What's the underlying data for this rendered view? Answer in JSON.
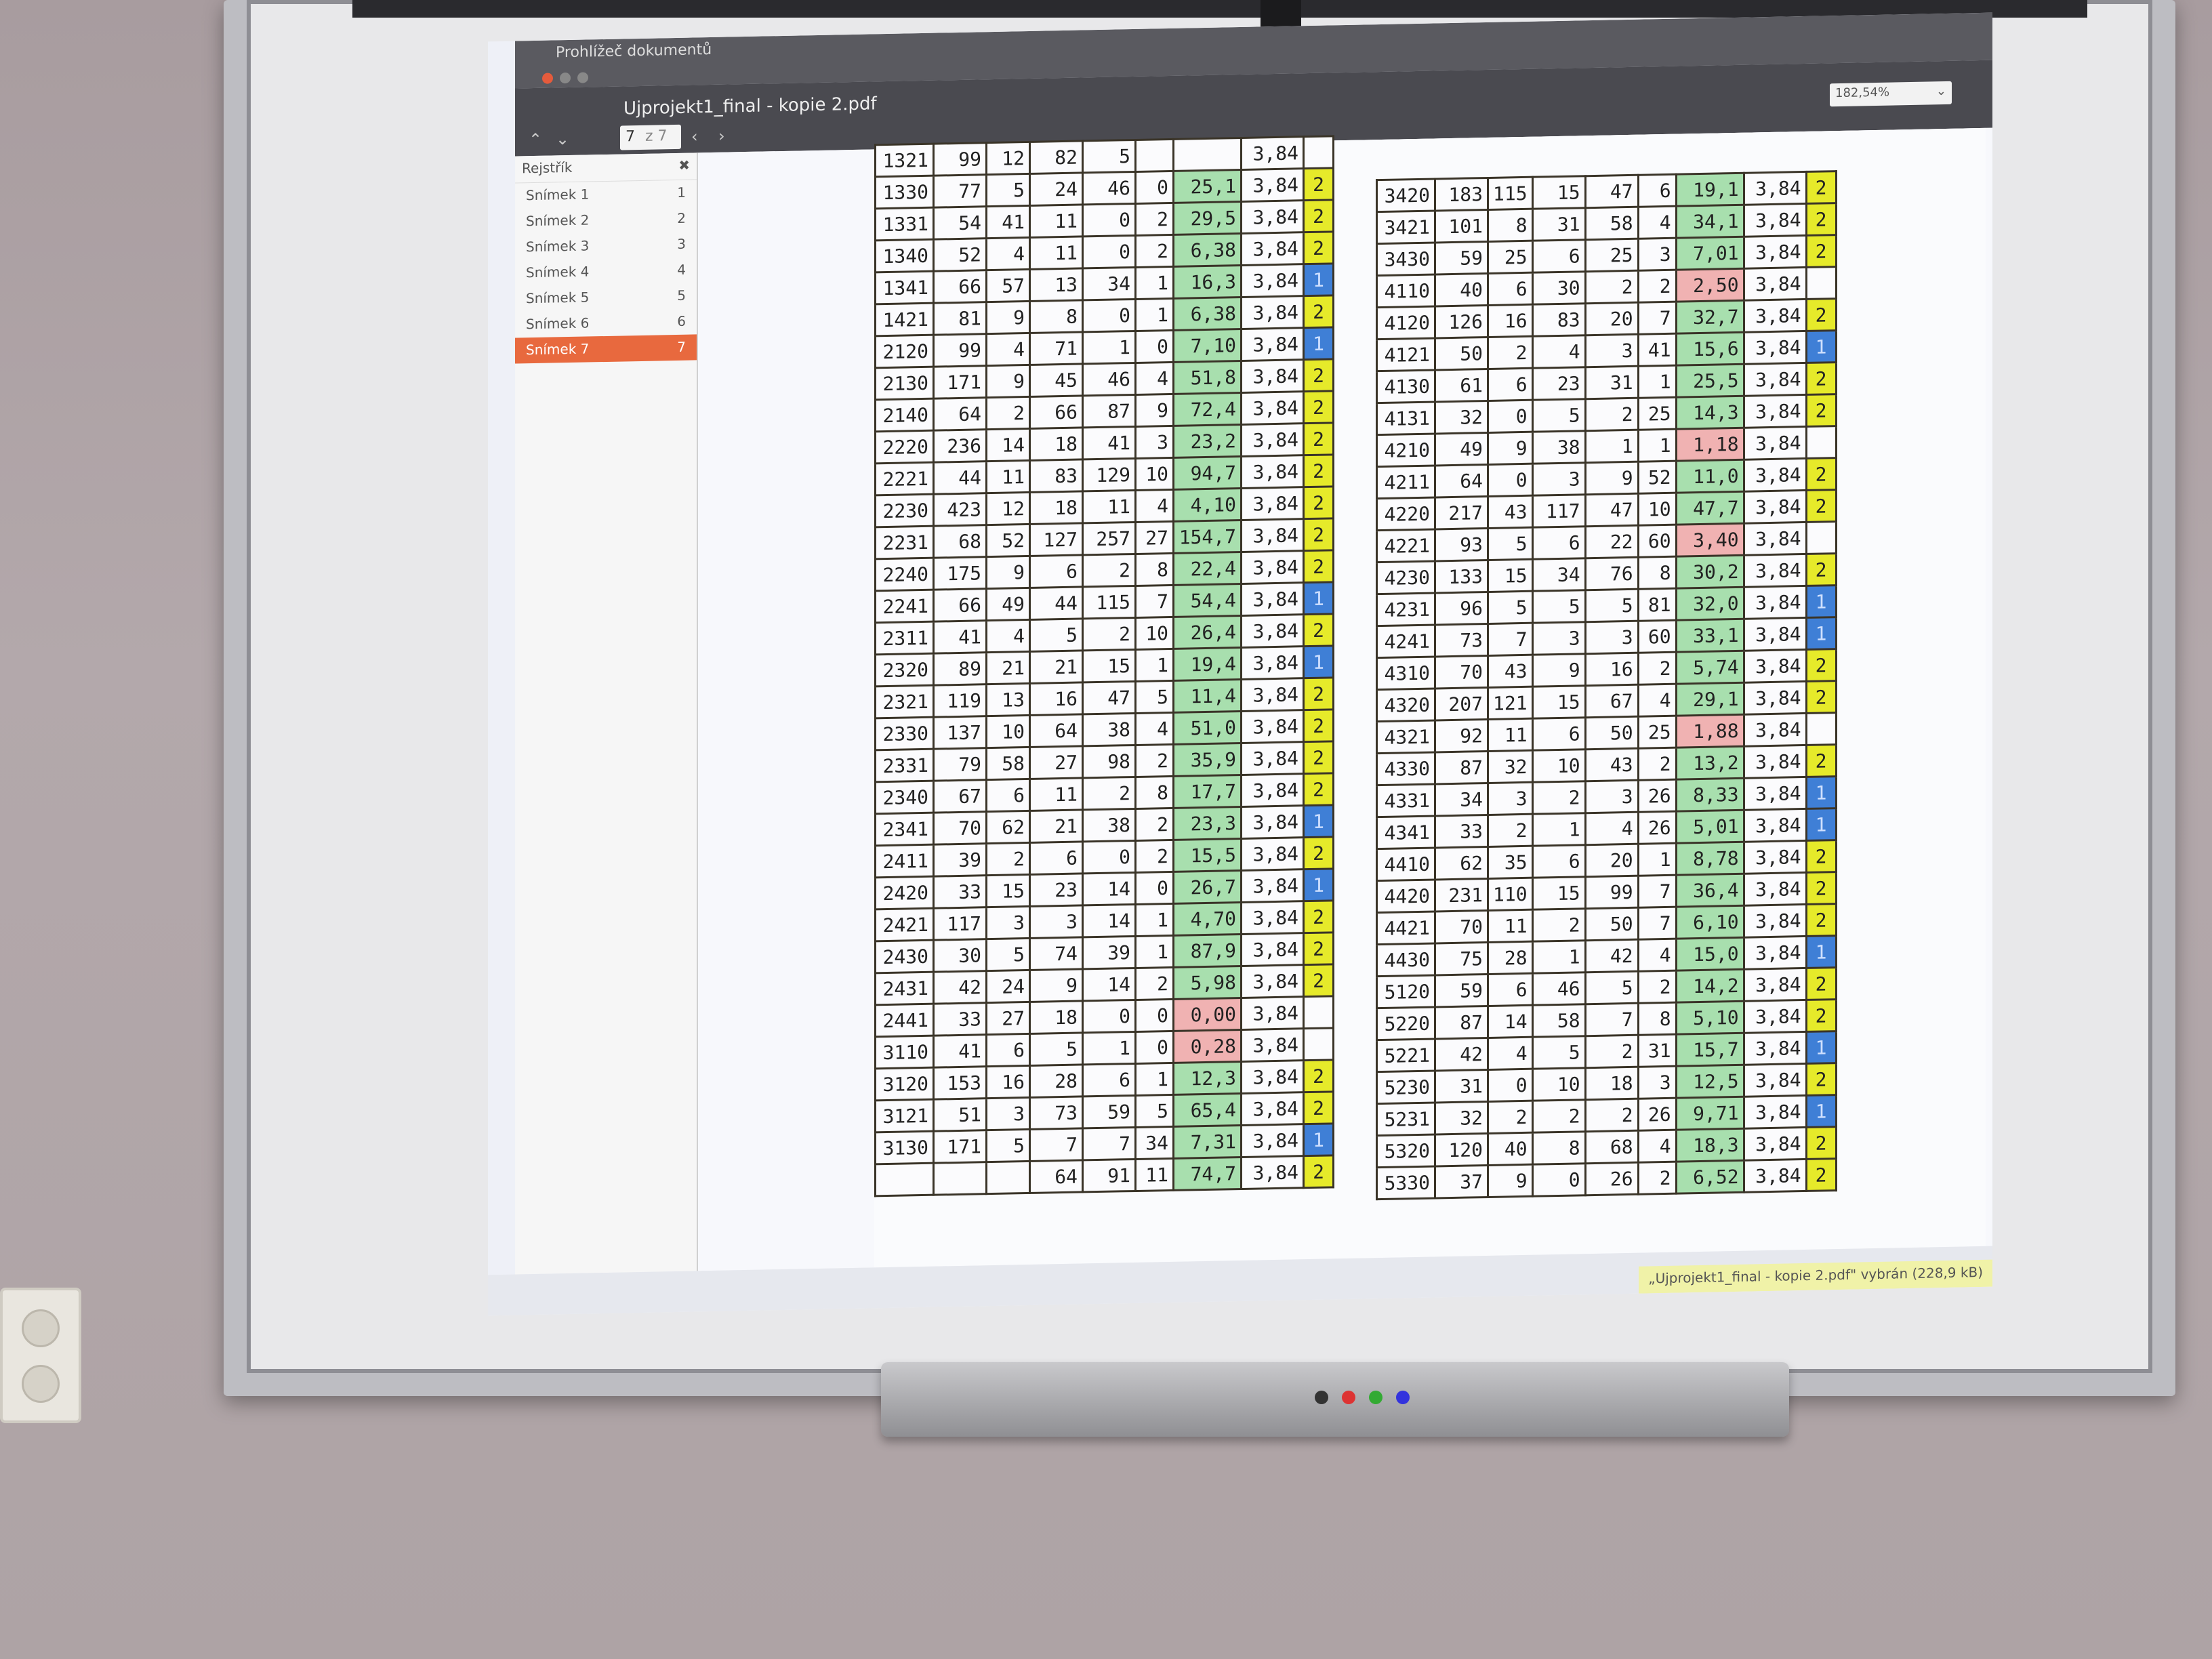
{
  "window": {
    "app_name": "Prohlížeč dokumentů",
    "document_title": "Ujprojekt1_final - kopie 2.pdf",
    "page_field": "7",
    "page_total": "z 7",
    "zoom": "182,54%"
  },
  "sidebar": {
    "header": "Rejstřík",
    "items": [
      {
        "label": "Snímek 1",
        "page": "1"
      },
      {
        "label": "Snímek 2",
        "page": "2"
      },
      {
        "label": "Snímek 3",
        "page": "3"
      },
      {
        "label": "Snímek 4",
        "page": "4"
      },
      {
        "label": "Snímek 5",
        "page": "5"
      },
      {
        "label": "Snímek 6",
        "page": "6"
      },
      {
        "label": "Snímek 7",
        "page": "7"
      }
    ]
  },
  "table_left": [
    [
      "1321",
      "99",
      "12",
      "82",
      "5",
      "",
      "",
      "3,84",
      ""
    ],
    [
      "1330",
      "77",
      "5",
      "24",
      "46",
      "0",
      "25,1",
      "3,84",
      "2"
    ],
    [
      "1331",
      "54",
      "41",
      "11",
      "0",
      "2",
      "29,5",
      "3,84",
      "2"
    ],
    [
      "1340",
      "52",
      "4",
      "11",
      "0",
      "2",
      "6,38",
      "3,84",
      "2"
    ],
    [
      "1341",
      "66",
      "57",
      "13",
      "34",
      "1",
      "16,3",
      "3,84",
      "1"
    ],
    [
      "1421",
      "81",
      "9",
      "8",
      "0",
      "1",
      "6,38",
      "3,84",
      "2"
    ],
    [
      "2120",
      "99",
      "4",
      "71",
      "1",
      "0",
      "7,10",
      "3,84",
      "1"
    ],
    [
      "2130",
      "171",
      "9",
      "45",
      "46",
      "4",
      "51,8",
      "3,84",
      "2"
    ],
    [
      "2140",
      "64",
      "2",
      "66",
      "87",
      "9",
      "72,4",
      "3,84",
      "2"
    ],
    [
      "2220",
      "236",
      "14",
      "18",
      "41",
      "3",
      "23,2",
      "3,84",
      "2"
    ],
    [
      "2221",
      "44",
      "11",
      "83",
      "129",
      "10",
      "94,7",
      "3,84",
      "2"
    ],
    [
      "2230",
      "423",
      "12",
      "18",
      "11",
      "4",
      "4,10",
      "3,84",
      "2"
    ],
    [
      "2231",
      "68",
      "52",
      "127",
      "257",
      "27",
      "154,7",
      "3,84",
      "2"
    ],
    [
      "2240",
      "175",
      "9",
      "6",
      "2",
      "8",
      "22,4",
      "3,84",
      "2"
    ],
    [
      "2241",
      "66",
      "49",
      "44",
      "115",
      "7",
      "54,4",
      "3,84",
      "1"
    ],
    [
      "2311",
      "41",
      "4",
      "5",
      "2",
      "10",
      "26,4",
      "3,84",
      "2"
    ],
    [
      "2320",
      "89",
      "21",
      "21",
      "15",
      "1",
      "19,4",
      "3,84",
      "1"
    ],
    [
      "2321",
      "119",
      "13",
      "16",
      "47",
      "5",
      "11,4",
      "3,84",
      "2"
    ],
    [
      "2330",
      "137",
      "10",
      "64",
      "38",
      "4",
      "51,0",
      "3,84",
      "2"
    ],
    [
      "2331",
      "79",
      "58",
      "27",
      "98",
      "2",
      "35,9",
      "3,84",
      "2"
    ],
    [
      "2340",
      "67",
      "6",
      "11",
      "2",
      "8",
      "17,7",
      "3,84",
      "2"
    ],
    [
      "2341",
      "70",
      "62",
      "21",
      "38",
      "2",
      "23,3",
      "3,84",
      "1"
    ],
    [
      "2411",
      "39",
      "2",
      "6",
      "0",
      "2",
      "15,5",
      "3,84",
      "2"
    ],
    [
      "2420",
      "33",
      "15",
      "23",
      "14",
      "0",
      "26,7",
      "3,84",
      "1"
    ],
    [
      "2421",
      "117",
      "3",
      "3",
      "14",
      "1",
      "4,70",
      "3,84",
      "2"
    ],
    [
      "2430",
      "30",
      "5",
      "74",
      "39",
      "1",
      "87,9",
      "3,84",
      "2"
    ],
    [
      "2431",
      "42",
      "24",
      "9",
      "14",
      "2",
      "5,98",
      "3,84",
      "2"
    ],
    [
      "2441",
      "33",
      "27",
      "18",
      "0",
      "0",
      "0,00",
      "3,84",
      ""
    ],
    [
      "3110",
      "41",
      "6",
      "5",
      "1",
      "0",
      "0,28",
      "3,84",
      ""
    ],
    [
      "3120",
      "153",
      "16",
      "28",
      "6",
      "1",
      "12,3",
      "3,84",
      "2"
    ],
    [
      "3121",
      "51",
      "3",
      "73",
      "59",
      "5",
      "65,4",
      "3,84",
      "2"
    ],
    [
      "3130",
      "171",
      "5",
      "7",
      "7",
      "34",
      "7,31",
      "3,84",
      "1"
    ],
    [
      "",
      "",
      "",
      "64",
      "91",
      "11",
      "74,7",
      "3,84",
      "2"
    ]
  ],
  "table_right": [
    [
      "3420",
      "183",
      "115",
      "15",
      "47",
      "6",
      "19,1",
      "3,84",
      "2"
    ],
    [
      "3421",
      "101",
      "8",
      "31",
      "58",
      "4",
      "34,1",
      "3,84",
      "2"
    ],
    [
      "3430",
      "59",
      "25",
      "6",
      "25",
      "3",
      "7,01",
      "3,84",
      "2"
    ],
    [
      "4110",
      "40",
      "6",
      "30",
      "2",
      "2",
      "2,50",
      "3,84",
      ""
    ],
    [
      "4120",
      "126",
      "16",
      "83",
      "20",
      "7",
      "32,7",
      "3,84",
      "2"
    ],
    [
      "4121",
      "50",
      "2",
      "4",
      "3",
      "41",
      "15,6",
      "3,84",
      "1"
    ],
    [
      "4130",
      "61",
      "6",
      "23",
      "31",
      "1",
      "25,5",
      "3,84",
      "2"
    ],
    [
      "4131",
      "32",
      "0",
      "5",
      "2",
      "25",
      "14,3",
      "3,84",
      "2"
    ],
    [
      "4210",
      "49",
      "9",
      "38",
      "1",
      "1",
      "1,18",
      "3,84",
      ""
    ],
    [
      "4211",
      "64",
      "0",
      "3",
      "9",
      "52",
      "11,0",
      "3,84",
      "2"
    ],
    [
      "4220",
      "217",
      "43",
      "117",
      "47",
      "10",
      "47,7",
      "3,84",
      "2"
    ],
    [
      "4221",
      "93",
      "5",
      "6",
      "22",
      "60",
      "3,40",
      "3,84",
      ""
    ],
    [
      "4230",
      "133",
      "15",
      "34",
      "76",
      "8",
      "30,2",
      "3,84",
      "2"
    ],
    [
      "4231",
      "96",
      "5",
      "5",
      "5",
      "81",
      "32,0",
      "3,84",
      "1"
    ],
    [
      "4241",
      "73",
      "7",
      "3",
      "3",
      "60",
      "33,1",
      "3,84",
      "1"
    ],
    [
      "4310",
      "70",
      "43",
      "9",
      "16",
      "2",
      "5,74",
      "3,84",
      "2"
    ],
    [
      "4320",
      "207",
      "121",
      "15",
      "67",
      "4",
      "29,1",
      "3,84",
      "2"
    ],
    [
      "4321",
      "92",
      "11",
      "6",
      "50",
      "25",
      "1,88",
      "3,84",
      ""
    ],
    [
      "4330",
      "87",
      "32",
      "10",
      "43",
      "2",
      "13,2",
      "3,84",
      "2"
    ],
    [
      "4331",
      "34",
      "3",
      "2",
      "3",
      "26",
      "8,33",
      "3,84",
      "1"
    ],
    [
      "4341",
      "33",
      "2",
      "1",
      "4",
      "26",
      "5,01",
      "3,84",
      "1"
    ],
    [
      "4410",
      "62",
      "35",
      "6",
      "20",
      "1",
      "8,78",
      "3,84",
      "2"
    ],
    [
      "4420",
      "231",
      "110",
      "15",
      "99",
      "7",
      "36,4",
      "3,84",
      "2"
    ],
    [
      "4421",
      "70",
      "11",
      "2",
      "50",
      "7",
      "6,10",
      "3,84",
      "2"
    ],
    [
      "4430",
      "75",
      "28",
      "1",
      "42",
      "4",
      "15,0",
      "3,84",
      "1"
    ],
    [
      "5120",
      "59",
      "6",
      "46",
      "5",
      "2",
      "14,2",
      "3,84",
      "2"
    ],
    [
      "5220",
      "87",
      "14",
      "58",
      "7",
      "8",
      "5,10",
      "3,84",
      "2"
    ],
    [
      "5221",
      "42",
      "4",
      "5",
      "2",
      "31",
      "15,7",
      "3,84",
      "1"
    ],
    [
      "5230",
      "31",
      "0",
      "10",
      "18",
      "3",
      "12,5",
      "3,84",
      "2"
    ],
    [
      "5231",
      "32",
      "2",
      "2",
      "2",
      "26",
      "9,71",
      "3,84",
      "1"
    ],
    [
      "5320",
      "120",
      "40",
      "8",
      "68",
      "4",
      "18,3",
      "3,84",
      "2"
    ],
    [
      "5330",
      "37",
      "9",
      "0",
      "26",
      "2",
      "6,52",
      "3,84",
      "2"
    ]
  ],
  "colors": {
    "green": "#a8dfae",
    "red": "#f0b2b2",
    "yellow": "#e6ea2a",
    "blue": "#3f7fd6",
    "active_item": "#e8693e"
  },
  "status": "„Ujprojekt1_final - kopie 2.pdf\" vybrán (228,9 kB)"
}
